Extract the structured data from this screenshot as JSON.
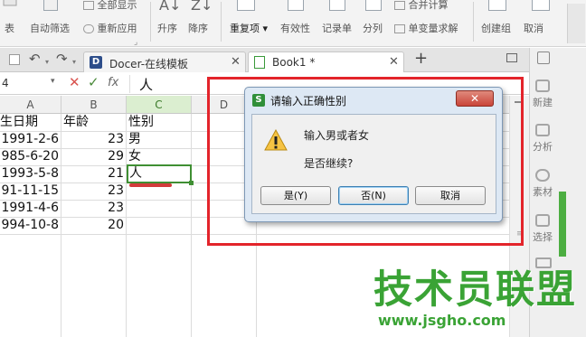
{
  "ribbon": {
    "items": [
      {
        "label": "全部显示"
      },
      {
        "label": "自动筛选"
      },
      {
        "label": "重新应用"
      },
      {
        "label": "升序"
      },
      {
        "label": "降序"
      },
      {
        "label": "重复项"
      },
      {
        "label": "有效性"
      },
      {
        "label": "记录单"
      },
      {
        "label": "分列"
      },
      {
        "label": "合并计算"
      },
      {
        "label": "单变量求解"
      },
      {
        "label": "创建组"
      },
      {
        "label": "取消"
      }
    ]
  },
  "tabs": [
    {
      "label": "Docer-在线模板"
    },
    {
      "label": "Book1 *"
    }
  ],
  "formula_bar": {
    "name_box": "4",
    "fx_label": "fx",
    "value": "人"
  },
  "grid": {
    "columns": [
      "A",
      "B",
      "C",
      "D"
    ],
    "rows": [
      {
        "a": "生日期",
        "b": "年龄",
        "c": "性别"
      },
      {
        "a": "1991-2-6",
        "b": "23",
        "c": "男"
      },
      {
        "a": "985-6-20",
        "b": "29",
        "c": "女"
      },
      {
        "a": "1993-5-8",
        "b": "21",
        "c": "人"
      },
      {
        "a": "91-11-15",
        "b": "23",
        "c": ""
      },
      {
        "a": "1991-4-6",
        "b": "23",
        "c": ""
      },
      {
        "a": "994-10-8",
        "b": "20",
        "c": ""
      }
    ]
  },
  "right_panel": {
    "items": [
      {
        "label": "新建"
      },
      {
        "label": "分析"
      },
      {
        "label": "素材"
      },
      {
        "label": "选择"
      }
    ]
  },
  "dialog": {
    "title": "请输入正确性别",
    "message": "输入男或者女",
    "question": "是否继续?",
    "buttons": {
      "yes": "是(Y)",
      "no": "否(N)",
      "cancel": "取消"
    }
  },
  "watermark": {
    "main": "技术员联盟",
    "url": "www.jsgho.com"
  },
  "colors": {
    "accent_green": "#3aa335",
    "annotation_red": "#e3242b",
    "dialog_close_red": "#c9453a"
  }
}
